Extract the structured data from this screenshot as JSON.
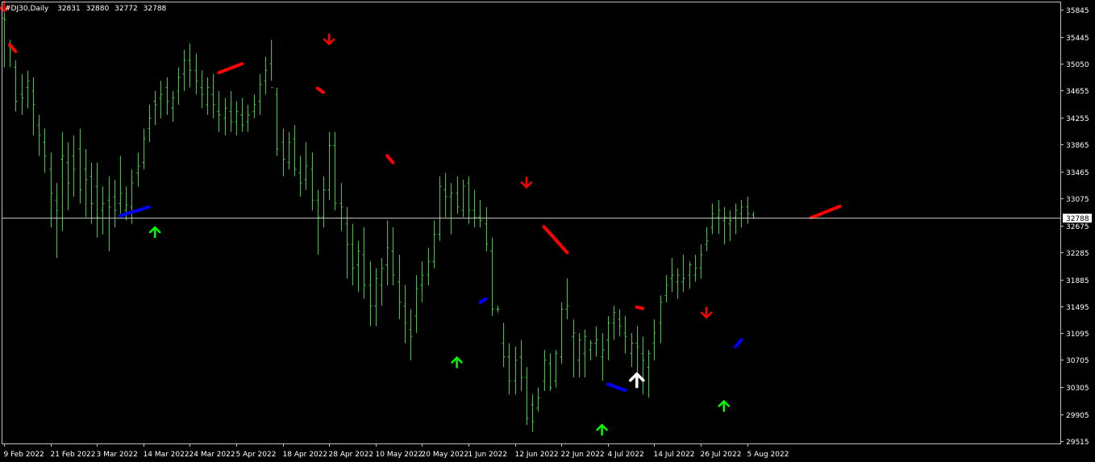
{
  "colors": {
    "background": "#000000",
    "frame": "#c0c0c0",
    "bar": "#33cc33",
    "price_line": "#c0c0c0",
    "price_tag_bg": "#ffffff",
    "trend_down": "#ff0000",
    "trend_up": "#0000ff",
    "arrow_buy": "#00ff00",
    "arrow_sell": "#ff0000",
    "arrow_buy_strong": "#ffffff"
  },
  "chart_data": {
    "type": "ohlc",
    "symbol": "#DJ30",
    "timeframe": "Daily",
    "header": {
      "symbol_tf": "#DJ30,Daily",
      "open": "32831",
      "high": "32880",
      "low": "32772",
      "close": "32788"
    },
    "current_price": 32788,
    "current_price_label": "32788",
    "ylim": [
      29480,
      35950
    ],
    "y_ticks": [
      "35845",
      "35445",
      "35050",
      "34655",
      "34255",
      "33865",
      "33465",
      "33075",
      "32675",
      "32285",
      "31885",
      "31495",
      "31095",
      "30705",
      "30305",
      "29905",
      "29515"
    ],
    "x_ticks": [
      {
        "label": "9 Feb 2022",
        "bar": 0
      },
      {
        "label": "21 Feb 2022",
        "bar": 8
      },
      {
        "label": "3 Mar 2022",
        "bar": 16
      },
      {
        "label": "14 Mar 2022",
        "bar": 24
      },
      {
        "label": "24 Mar 2022",
        "bar": 32
      },
      {
        "label": "5 Apr 2022",
        "bar": 40
      },
      {
        "label": "18 Apr 2022",
        "bar": 48
      },
      {
        "label": "28 Apr 2022",
        "bar": 56
      },
      {
        "label": "10 May 2022",
        "bar": 64
      },
      {
        "label": "20 May 2022",
        "bar": 72
      },
      {
        "label": "1 Jun 2022",
        "bar": 80
      },
      {
        "label": "12 Jun 2022",
        "bar": 88
      },
      {
        "label": "22 Jun 2022",
        "bar": 96
      },
      {
        "label": "4 Jul 2022",
        "bar": 104
      },
      {
        "label": "14 Jul 2022",
        "bar": 112
      },
      {
        "label": "26 Jul 2022",
        "bar": 120
      },
      {
        "label": "5 Aug 2022",
        "bar": 128
      }
    ],
    "bars": [
      [
        35720,
        35900,
        35000,
        35700
      ],
      [
        35300,
        35400,
        35000,
        35250
      ],
      [
        35000,
        35100,
        34350,
        34500
      ],
      [
        34600,
        34900,
        34300,
        34550
      ],
      [
        34700,
        34950,
        34400,
        34800
      ],
      [
        34650,
        34850,
        34000,
        34450
      ],
      [
        34150,
        34300,
        33700,
        34000
      ],
      [
        33900,
        34100,
        33450,
        33700
      ],
      [
        33500,
        33750,
        32650,
        33150
      ],
      [
        33050,
        33300,
        32200,
        32900
      ],
      [
        33650,
        34050,
        32600,
        33700
      ],
      [
        33600,
        33900,
        32900,
        33300
      ],
      [
        33700,
        34000,
        33100,
        33500
      ],
      [
        33800,
        34100,
        33000,
        33200
      ],
      [
        33500,
        33800,
        32800,
        33350
      ],
      [
        33400,
        33600,
        32700,
        33000
      ],
      [
        33250,
        33600,
        32500,
        32800
      ],
      [
        32900,
        33250,
        32550,
        33000
      ],
      [
        33050,
        33400,
        32300,
        32950
      ],
      [
        33100,
        33350,
        32650,
        32900
      ],
      [
        33000,
        33700,
        32850,
        33150
      ],
      [
        32900,
        33250,
        32750,
        32980
      ],
      [
        32950,
        33500,
        32700,
        33300
      ],
      [
        33450,
        33750,
        33250,
        33550
      ],
      [
        33600,
        34100,
        33500,
        33950
      ],
      [
        34100,
        34450,
        33900,
        34250
      ],
      [
        34500,
        34650,
        34150,
        34450
      ],
      [
        34550,
        34800,
        34250,
        34600
      ],
      [
        34700,
        34850,
        34300,
        34500
      ],
      [
        34400,
        34650,
        34200,
        34550
      ],
      [
        34650,
        35000,
        34450,
        34850
      ],
      [
        34900,
        35250,
        34650,
        35100
      ],
      [
        35100,
        35350,
        34700,
        34950
      ],
      [
        34950,
        35200,
        34600,
        34800
      ],
      [
        34700,
        34950,
        34400,
        34600
      ],
      [
        34450,
        34850,
        34300,
        34700
      ],
      [
        34600,
        34900,
        34250,
        34450
      ],
      [
        34350,
        34650,
        34050,
        34300
      ],
      [
        34250,
        34550,
        34000,
        34400
      ],
      [
        34350,
        34650,
        34050,
        34200
      ],
      [
        34200,
        34500,
        34000,
        34350
      ],
      [
        34300,
        34550,
        34050,
        34150
      ],
      [
        34200,
        34450,
        34050,
        34300
      ],
      [
        34350,
        34600,
        34250,
        34450
      ],
      [
        34500,
        34900,
        34300,
        34750
      ],
      [
        34800,
        35150,
        34600,
        34950
      ],
      [
        35050,
        35400,
        34800,
        34700
      ],
      [
        34600,
        34700,
        33700,
        33800
      ],
      [
        33900,
        34100,
        33400,
        33650
      ],
      [
        33600,
        34050,
        33500,
        33900
      ],
      [
        33950,
        34150,
        33400,
        33500
      ],
      [
        33450,
        33700,
        33100,
        33300
      ],
      [
        33350,
        33900,
        33200,
        33550
      ],
      [
        33500,
        33750,
        32900,
        33050
      ],
      [
        33050,
        33200,
        32250,
        32800
      ],
      [
        32800,
        33400,
        32650,
        33200
      ],
      [
        33200,
        34050,
        33050,
        33850
      ],
      [
        33850,
        34050,
        32900,
        33000
      ],
      [
        33000,
        33300,
        32600,
        32950
      ],
      [
        32700,
        32950,
        31900,
        32400
      ],
      [
        32400,
        32700,
        31800,
        32050
      ],
      [
        32100,
        32450,
        31700,
        32300
      ],
      [
        32250,
        32650,
        31600,
        31800
      ],
      [
        31800,
        32150,
        31200,
        31500
      ],
      [
        31500,
        32050,
        31200,
        31900
      ],
      [
        31800,
        32200,
        31500,
        32050
      ],
      [
        32100,
        32750,
        31800,
        32350
      ],
      [
        32300,
        32650,
        31800,
        31950
      ],
      [
        31850,
        32250,
        31300,
        31550
      ],
      [
        31500,
        31800,
        30950,
        31250
      ],
      [
        31150,
        31450,
        30700,
        31050
      ],
      [
        31350,
        31950,
        31100,
        31750
      ],
      [
        31800,
        32150,
        31550,
        31950
      ],
      [
        31950,
        32350,
        31800,
        32150
      ],
      [
        32150,
        32750,
        32050,
        32550
      ],
      [
        32550,
        33400,
        32450,
        33250
      ],
      [
        33200,
        33450,
        32800,
        33100
      ],
      [
        33100,
        33300,
        32550,
        33150
      ],
      [
        33150,
        33400,
        32850,
        32950
      ],
      [
        32900,
        33350,
        32800,
        33250
      ],
      [
        33300,
        33400,
        32700,
        32900
      ],
      [
        32900,
        33200,
        32650,
        32800
      ],
      [
        32800,
        33050,
        32650,
        32750
      ],
      [
        32700,
        32950,
        32300,
        32400
      ],
      [
        32300,
        32500,
        31350,
        31450
      ],
      [
        31450,
        31500,
        31400,
        31450
      ],
      [
        30950,
        31250,
        30600,
        30750
      ],
      [
        30750,
        30950,
        30200,
        30400
      ],
      [
        30400,
        30900,
        30200,
        30700
      ],
      [
        30750,
        31000,
        30250,
        30450
      ],
      [
        30450,
        30600,
        29750,
        29850
      ],
      [
        30050,
        30200,
        29650,
        29800
      ],
      [
        30000,
        30300,
        29950,
        30150
      ],
      [
        30400,
        30850,
        30250,
        30700
      ],
      [
        30650,
        30800,
        30250,
        30300
      ],
      [
        30400,
        30850,
        30300,
        30800
      ],
      [
        30750,
        31550,
        30650,
        31450
      ],
      [
        31450,
        31900,
        31300,
        31500
      ],
      [
        31050,
        31300,
        30450,
        31100
      ],
      [
        30700,
        31100,
        30450,
        31000
      ],
      [
        30800,
        31150,
        30450,
        31050
      ],
      [
        30850,
        31000,
        30700,
        30950
      ],
      [
        30950,
        31200,
        30750,
        31000
      ],
      [
        30750,
        31100,
        30400,
        30850
      ],
      [
        31000,
        31350,
        30700,
        31250
      ],
      [
        31250,
        31500,
        31000,
        31400
      ],
      [
        31300,
        31450,
        31050,
        31200
      ],
      [
        31100,
        31350,
        30800,
        31050
      ],
      [
        30800,
        31100,
        30600,
        30950
      ],
      [
        30950,
        31200,
        30450,
        30900
      ],
      [
        30800,
        31050,
        30200,
        30700
      ],
      [
        30600,
        30850,
        30150,
        30800
      ],
      [
        30950,
        31300,
        30700,
        31100
      ],
      [
        31250,
        31650,
        30950,
        31550
      ],
      [
        31650,
        31950,
        31550,
        31800
      ],
      [
        31900,
        32200,
        31700,
        31950
      ],
      [
        31850,
        32050,
        31600,
        31950
      ],
      [
        31850,
        32250,
        31700,
        31900
      ],
      [
        31950,
        32150,
        31750,
        32100
      ],
      [
        31950,
        32250,
        31850,
        32050
      ],
      [
        32050,
        32400,
        31900,
        32250
      ],
      [
        32400,
        32650,
        32300,
        32450
      ],
      [
        32650,
        33000,
        32550,
        32850
      ],
      [
        32800,
        33050,
        32550,
        32900
      ],
      [
        32750,
        32950,
        32400,
        32800
      ],
      [
        32700,
        32900,
        32450,
        32750
      ],
      [
        32800,
        33000,
        32550,
        32900
      ],
      [
        32850,
        33050,
        32650,
        32950
      ],
      [
        32950,
        33100,
        32700,
        32850
      ],
      [
        32831,
        32880,
        32772,
        32788
      ]
    ],
    "trend_segments": [
      {
        "color": "red",
        "from": [
          1,
          35330
        ],
        "to": [
          2,
          35230
        ]
      },
      {
        "color": "blue",
        "from": [
          20,
          32820
        ],
        "to": [
          25,
          32950
        ]
      },
      {
        "color": "red",
        "from": [
          37,
          34920
        ],
        "to": [
          41,
          35050
        ]
      },
      {
        "color": "red",
        "from": [
          54,
          34690
        ],
        "to": [
          55,
          34630
        ]
      },
      {
        "color": "red",
        "from": [
          66,
          33700
        ],
        "to": [
          67,
          33600
        ]
      },
      {
        "color": "blue",
        "from": [
          82,
          31550
        ],
        "to": [
          83,
          31600
        ]
      },
      {
        "color": "red",
        "from": [
          93,
          32660
        ],
        "to": [
          97,
          32280
        ]
      },
      {
        "color": "blue",
        "from": [
          104,
          30350
        ],
        "to": [
          107,
          30260
        ]
      },
      {
        "color": "red",
        "from": [
          109,
          31480
        ],
        "to": [
          110,
          31460
        ]
      },
      {
        "color": "blue",
        "from": [
          126,
          30900
        ],
        "to": [
          127,
          31000
        ]
      },
      {
        "color": "red",
        "from": [
          139,
          32790
        ],
        "to": [
          144,
          32960
        ]
      }
    ],
    "signals": [
      {
        "type": "sell",
        "bar": 0,
        "price": 35960
      },
      {
        "type": "buy",
        "bar": 26,
        "price": 32650
      },
      {
        "type": "sell",
        "bar": 56,
        "price": 35480
      },
      {
        "type": "buy",
        "bar": 78,
        "price": 30740
      },
      {
        "type": "sell",
        "bar": 90,
        "price": 33380
      },
      {
        "type": "buy",
        "bar": 103,
        "price": 29750
      },
      {
        "type": "buy_strong",
        "bar": 109,
        "price": 30500
      },
      {
        "type": "sell",
        "bar": 121,
        "price": 31470
      },
      {
        "type": "buy",
        "bar": 124,
        "price": 30100
      }
    ]
  }
}
